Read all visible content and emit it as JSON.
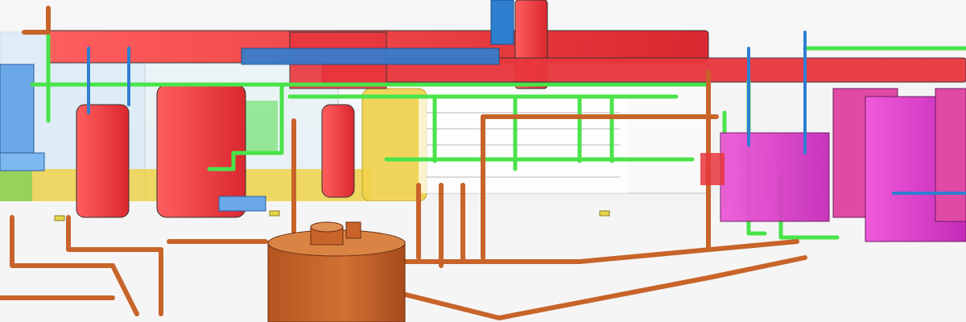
{
  "image": {
    "kind": "3D BIM/MEP model render of mechanical piping and ductwork",
    "visible_text": []
  },
  "palette": {
    "background": "#eeeeee",
    "supply_duct_red": "#e8363c",
    "return_duct_blue": "#2f7fd1",
    "pipe_green": "#49e34a",
    "pipe_orange": "#c8642a",
    "tank_orange": "#c86a2c",
    "equipment_magenta": "#e23bd1",
    "equipment_pink": "#e04aa4",
    "wall_yellow": "#f0d24a",
    "glass_blue": "#8fd0ff",
    "outline_dark": "#444444"
  },
  "objects": [
    {
      "name": "duct-red-main",
      "color": "supply_duct_red"
    },
    {
      "name": "duct-blue-main",
      "color": "return_duct_blue"
    },
    {
      "name": "pipe-network-green",
      "color": "pipe_green"
    },
    {
      "name": "pipe-network-orange",
      "color": "pipe_orange"
    },
    {
      "name": "tank-orange",
      "color": "tank_orange"
    },
    {
      "name": "equipment-magenta",
      "color": "equipment_magenta"
    }
  ]
}
